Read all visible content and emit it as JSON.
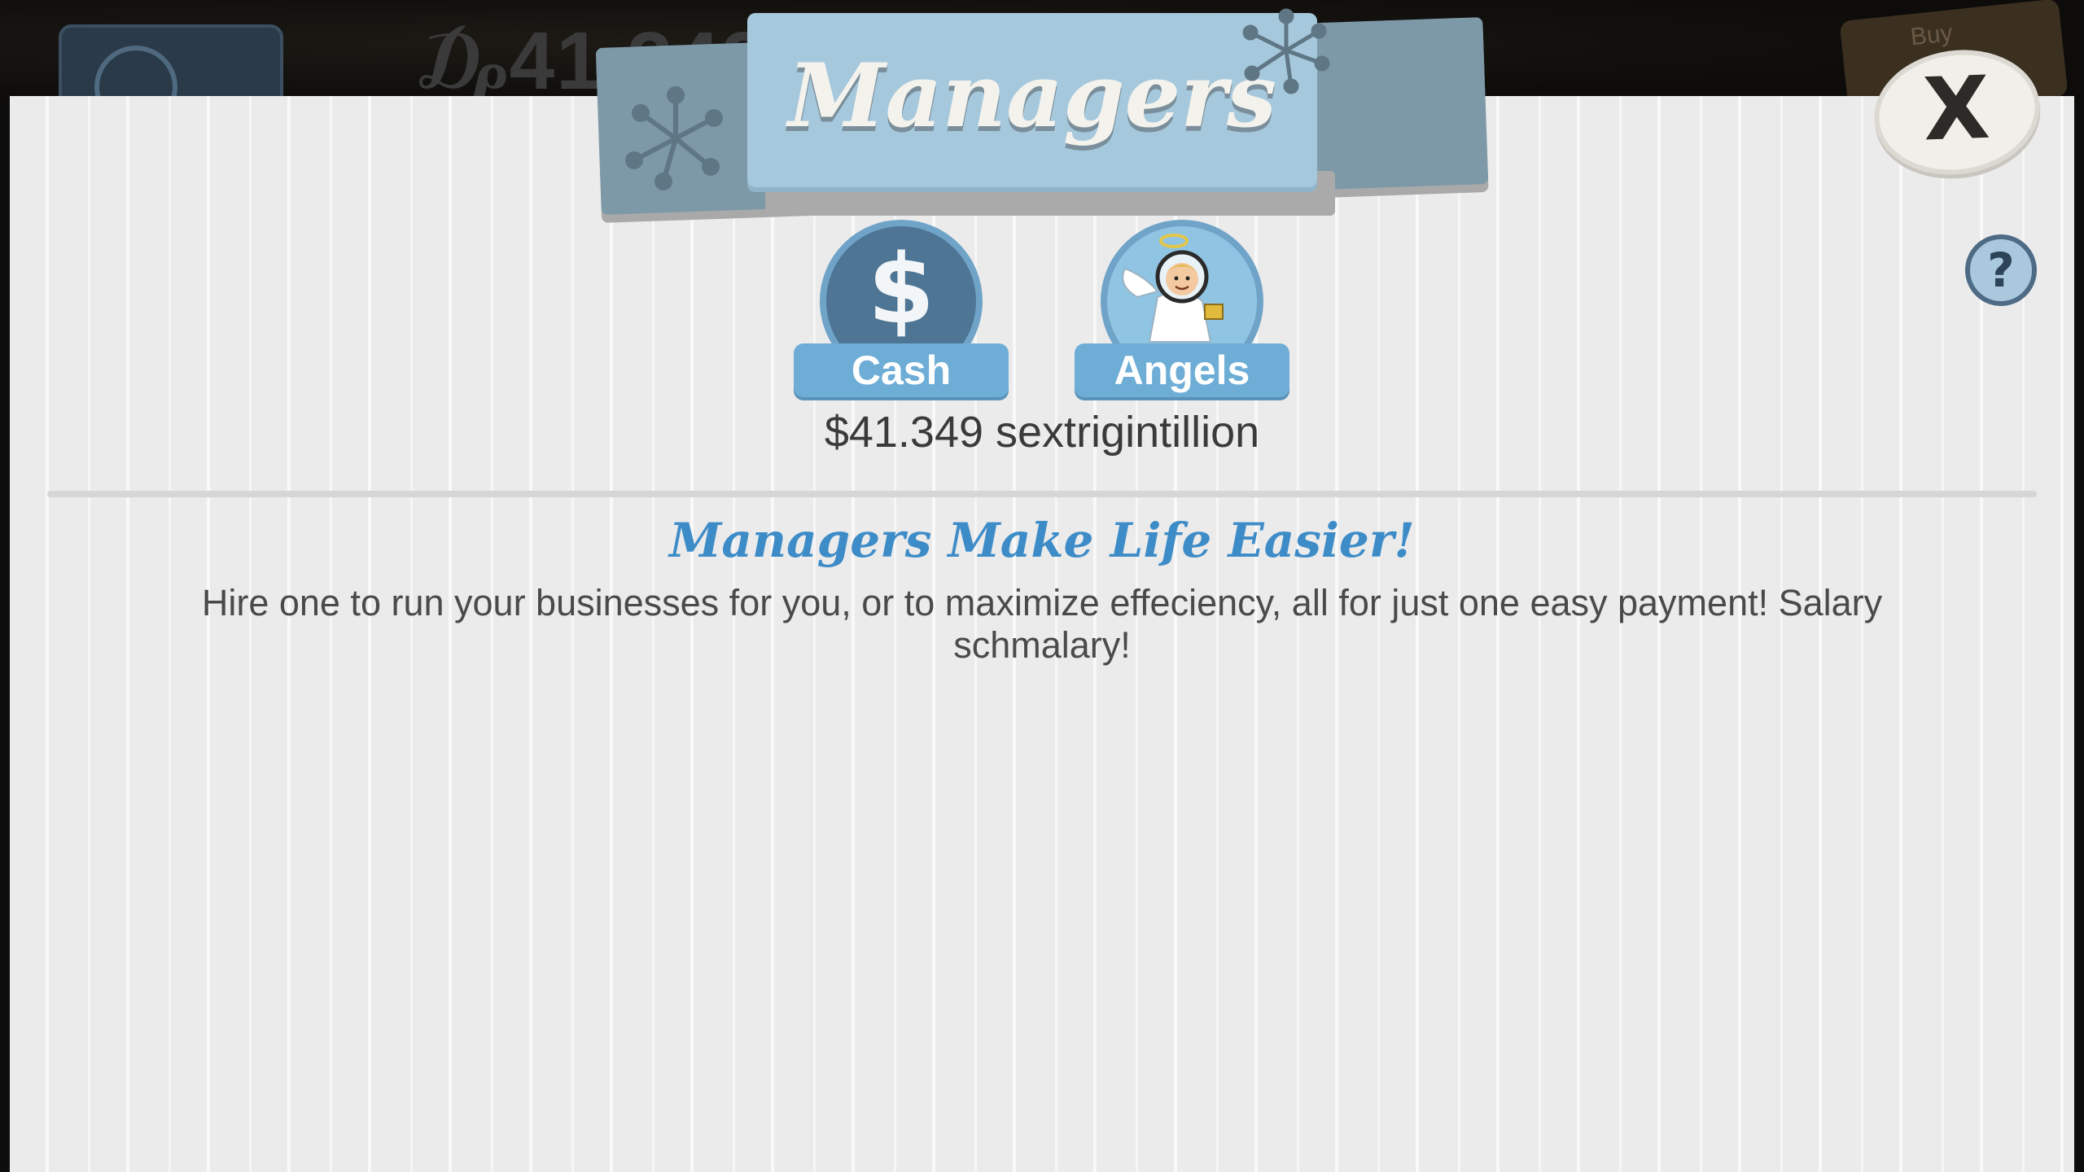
{
  "window": {
    "title": "Managers"
  },
  "background": {
    "money_text": "₯41,349",
    "tag_text": "Buy"
  },
  "header": {
    "title": "Managers",
    "close_label": "X",
    "help_label": "?"
  },
  "tabs": [
    {
      "id": "cash",
      "label": "Cash",
      "icon": "dollar-icon",
      "glyph": "$",
      "selected": true
    },
    {
      "id": "angels",
      "label": "Angels",
      "icon": "angel-icon",
      "selected": false
    }
  ],
  "balance": {
    "text": "$41.349 sextrigintillion"
  },
  "info": {
    "headline": "Managers Make Life Easier!",
    "description": "Hire one to run your businesses for you, or to maximize effeciency, all for just one easy payment! Salary schmalary!"
  },
  "colors": {
    "banner": "#a6c8dc",
    "banner_back": "#7d99a8",
    "tab_plate": "#6eadd6",
    "headline": "#3d8cc8",
    "panel": "#ebebeb"
  }
}
